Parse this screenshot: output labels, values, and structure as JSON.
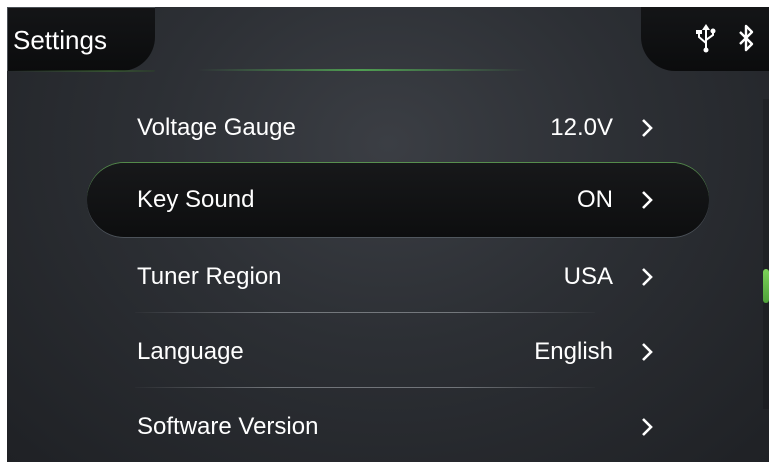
{
  "header": {
    "title": "Settings",
    "status_icons": [
      "usb-icon",
      "bluetooth-icon"
    ]
  },
  "settings": {
    "items": [
      {
        "label": "Voltage Gauge",
        "value": "12.0V",
        "selected": false
      },
      {
        "label": "Key Sound",
        "value": "ON",
        "selected": true
      },
      {
        "label": "Tuner Region",
        "value": "USA",
        "selected": false
      },
      {
        "label": "Language",
        "value": "English",
        "selected": false
      },
      {
        "label": "Software Version",
        "value": "",
        "selected": false
      }
    ]
  },
  "colors": {
    "accent": "#5ec84a",
    "background": "#2c2f34",
    "text": "#ffffff"
  },
  "scrollbar": {
    "position_fraction": 0.5
  }
}
